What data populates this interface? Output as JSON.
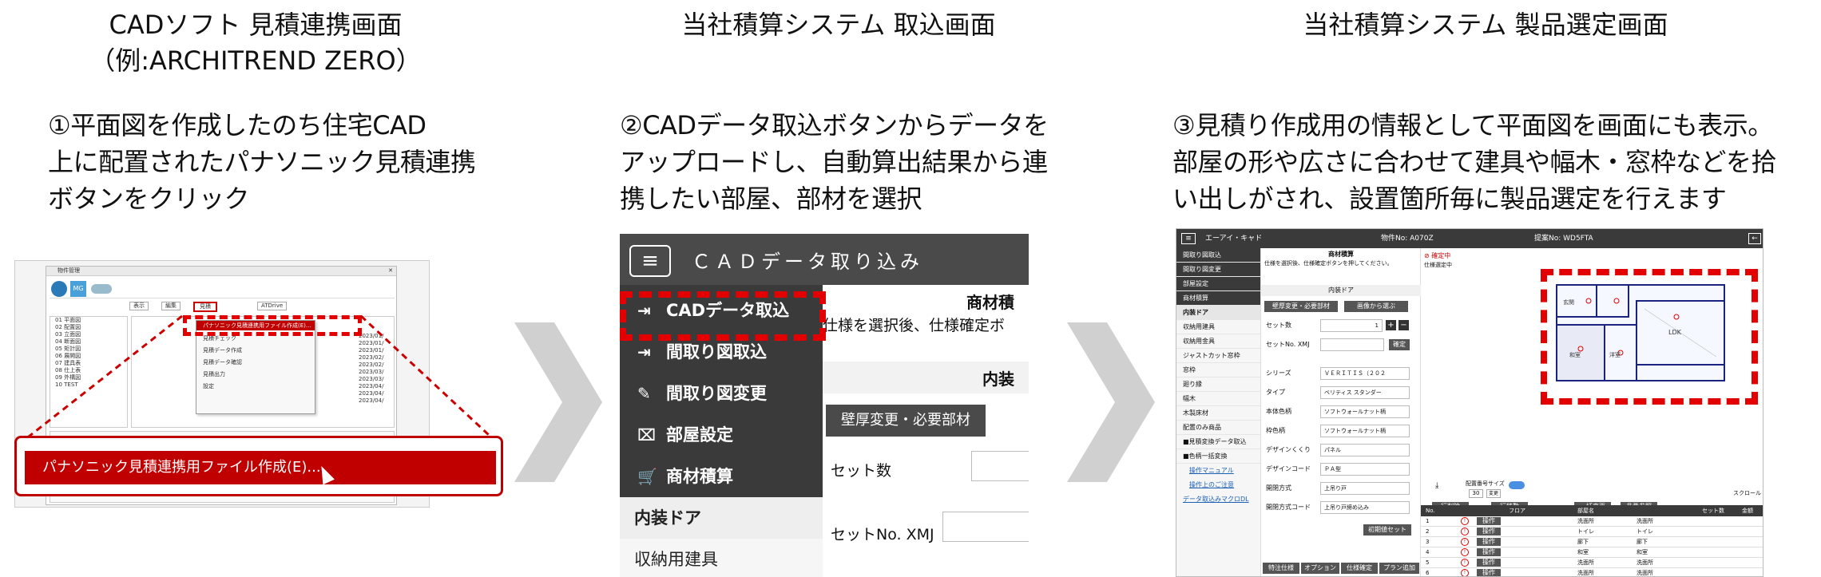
{
  "columns": [
    {
      "title": "CADソフト 見積連携画面",
      "subtitle": "（例:ARCHITREND ZERO）",
      "description": [
        "①平面図を作成したのち住宅CAD",
        "上に配置されたパナソニック見積連携",
        "ボタンをクリック"
      ]
    },
    {
      "title": "当社積算システム 取込画面",
      "description": [
        "②CADデータ取込ボタンからデータを",
        "アップロードし、自動算出結果から連",
        "携したい部屋、部材を選択"
      ]
    },
    {
      "title": "当社積算システム 製品選定画面",
      "description": [
        "③見積り作成用の情報として平面図を画面にも表示。",
        "部屋の形や広さに合わせて建具や幅木・窓枠などを拾",
        "い出しがされ、設置箇所毎に製品選定を行えます"
      ]
    }
  ],
  "panel1": {
    "banner_label": "パナソニック見積連携用ファイル作成(E)...",
    "menu_label": "パナソニック見積連携用ファイル作成(E)...",
    "window_title": "物件管理",
    "toolbar": [
      "表示",
      "編集",
      "見積",
      "ATDrive"
    ],
    "tree_items": [
      "01 平面図",
      "02 配置図",
      "03 立面図",
      "04 断面図",
      "05 矩計図",
      "06 展開図",
      "07 建具表",
      "08 仕上表",
      "09 外構図",
      "10 TEST"
    ],
    "menu_items": [
      "見積チェック",
      "見積データ作成",
      "見積データ確認",
      "見積出力",
      "設定"
    ],
    "dates": [
      "2023/01/",
      "2023/01/",
      "2023/01/",
      "2023/02/",
      "2023/02/",
      "2023/03/",
      "2023/03/",
      "2023/04/",
      "2023/04/",
      "2023/04/"
    ]
  },
  "panel2": {
    "app_title": "ＣＡＤデータ取り込み",
    "menu_icon": "≡",
    "side_items": [
      {
        "label": "CADデータ取込",
        "icon": "import-icon"
      },
      {
        "label": "間取り図取込",
        "icon": "import-icon"
      },
      {
        "label": "間取り図変更",
        "icon": "edit-icon"
      },
      {
        "label": "部屋設定",
        "icon": "room-icon"
      },
      {
        "label": "商材積算",
        "icon": "cart-icon"
      }
    ],
    "side_sub_items": [
      "内装ドア",
      "収納用建具"
    ],
    "content": {
      "header": "商材積",
      "instruction": "仕様を選択後、仕様確定ボ",
      "section": "内装",
      "button": "壁厚変更・必要部材",
      "set_label": "セット数",
      "setno_label": "セットNo.  XMJ"
    }
  },
  "panel3": {
    "topbar": {
      "user": "エーアイ・キャド",
      "property": "物件No: A070Z",
      "proposal": "提案No: WD5FTA"
    },
    "side_items_dark": [
      "間取り図取込",
      "間取り図変更",
      "部屋設定",
      "商材積算"
    ],
    "side_items": [
      "内装ドア",
      "収納用建具",
      "収納用金具",
      "ジャストカット窓枠",
      "窓枠",
      "廻り縁",
      "幅木",
      "木製床材",
      "配置のみ商品",
      "■見積変換データ取込",
      "■色柄一括変換"
    ],
    "links": [
      "操作マニュアル",
      "操作上のご注意",
      "データ取込みマクロDL"
    ],
    "form_header": "商材積算",
    "form_note": "仕様を選択後、仕様確定ボタンを押してください。",
    "section": "内装ドア",
    "btn1": "壁厚変更・必要部材",
    "btn2": "画像から選ぶ",
    "fields": [
      {
        "label": "セット数",
        "value": "1"
      },
      {
        "label": "セットNo. XMJ",
        "value": ""
      },
      {
        "label": "シリーズ",
        "value": "ＶＥＲＩＴＩＳ（２０２"
      },
      {
        "label": "タイプ",
        "value": "ベリティス スタンダー"
      },
      {
        "label": "本体色柄",
        "value": "ソフトウォールナット柄"
      },
      {
        "label": "枠色柄",
        "value": "ソフトウォールナット柄"
      },
      {
        "label": "デザインくくり",
        "value": "パネル"
      },
      {
        "label": "デザインコード",
        "value": "ＰＡ型"
      },
      {
        "label": "開閉方式",
        "value": "上吊り戸"
      },
      {
        "label": "開閉方式コード",
        "value": "上吊り戸締め込み"
      }
    ],
    "confirm": "確定",
    "init_set": "初期値セット",
    "status": "確定中",
    "status_note": "仕様選定中",
    "bottom_buttons": [
      "特注仕様",
      "オプション",
      "仕様確定",
      "プラン追加"
    ],
    "table_toolbar": [
      "行削除",
      "行移動",
      "一括変更",
      "品番参照"
    ],
    "table_headers": [
      "No.",
      "フロア",
      "部屋名",
      "セット数",
      "金額"
    ],
    "rows": [
      {
        "no": "1",
        "room": "洗面所",
        "room2": "洗面所"
      },
      {
        "no": "2",
        "room": "トイレ",
        "room2": "トイレ"
      },
      {
        "no": "3",
        "room": "廊下",
        "room2": "廊下"
      },
      {
        "no": "4",
        "room": "和室",
        "room2": "和室"
      },
      {
        "no": "5",
        "room": "洗面所",
        "room2": "洗面所"
      },
      {
        "no": "6",
        "room": "洗面所",
        "room2": "洗面所"
      }
    ],
    "row_button": "操作",
    "plan_labels": [
      "LDK",
      "和室",
      "洋室",
      "玄関"
    ],
    "zoom_label": "配置番号サイズ",
    "zoom_value": "30",
    "zoom_btn": "変更",
    "scroll_label": "スクロール"
  }
}
